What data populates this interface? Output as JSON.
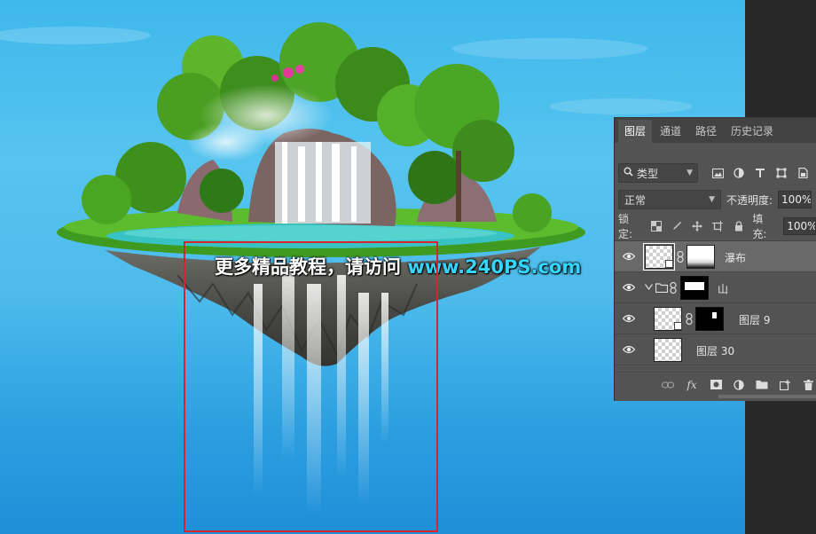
{
  "watermark": {
    "text": "更多精品教程，请访问 ",
    "url": "www.240PS.com"
  },
  "layers_panel": {
    "tabs": [
      {
        "label": "图层",
        "active": true
      },
      {
        "label": "通道",
        "active": false
      },
      {
        "label": "路径",
        "active": false
      },
      {
        "label": "历史记录",
        "active": false
      }
    ],
    "filter": {
      "kind_label": "类型",
      "icons": [
        "image-filter-icon",
        "adjustment-filter-icon",
        "type-filter-icon",
        "shape-filter-icon",
        "smart-object-filter-icon"
      ]
    },
    "blend_mode": "正常",
    "opacity_label": "不透明度:",
    "opacity_value": "100%",
    "lock_label": "锁定:",
    "fill_label": "填充:",
    "fill_value": "100%",
    "layers": [
      {
        "name": "瀑布",
        "selected": true
      },
      {
        "name": "山",
        "selected": false
      },
      {
        "name": "图层 9",
        "selected": false
      },
      {
        "name": "图层 30",
        "selected": false
      }
    ],
    "footer_icons": [
      "link-layers-icon",
      "fx-icon",
      "add-mask-icon",
      "adjustment-layer-icon",
      "new-group-icon",
      "new-layer-icon",
      "delete-layer-icon"
    ],
    "fx_label": "fx"
  },
  "colors": {
    "canvas_sky_top": "#3fb8ec",
    "canvas_sky_bottom": "#1f8fd8",
    "selection_box": "#d8242c",
    "watermark_url": "#34d6ff",
    "panel_bg": "#535353",
    "selected_row": "#696969"
  }
}
